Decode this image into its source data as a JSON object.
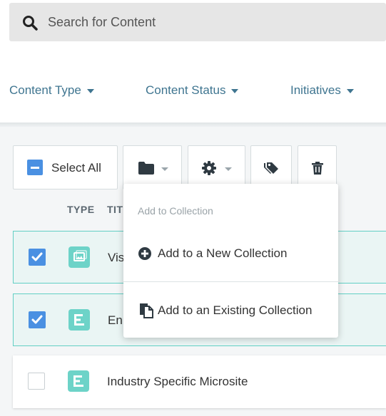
{
  "search": {
    "placeholder": "Search for Content",
    "icon": "search-icon"
  },
  "filters": [
    {
      "label": "Content Type"
    },
    {
      "label": "Content Status"
    },
    {
      "label": "Initiatives"
    }
  ],
  "toolbar": {
    "select_all_label": "Select All",
    "folder_icon": "folder-icon",
    "settings_icon": "gear-icon",
    "tags_icon": "tags-icon",
    "delete_icon": "trash-icon"
  },
  "table": {
    "columns": [
      "TYPE",
      "TIT"
    ],
    "rows": [
      {
        "checked": true,
        "type_icon": "image-icon",
        "title": "Vis"
      },
      {
        "checked": true,
        "type_icon": "microsite-icon",
        "title": "En"
      },
      {
        "checked": false,
        "type_icon": "microsite-icon",
        "title": "Industry Specific Microsite"
      }
    ]
  },
  "dropdown": {
    "header": "Add to Collection",
    "items": [
      {
        "icon": "plus-circle-icon",
        "label": "Add to a New Collection"
      },
      {
        "icon": "copy-icon",
        "label": "Add to an Existing Collection"
      }
    ]
  },
  "colors": {
    "accent": "#4a90e2",
    "teal": "#6dd3c8",
    "filter_text": "#3f7590"
  }
}
